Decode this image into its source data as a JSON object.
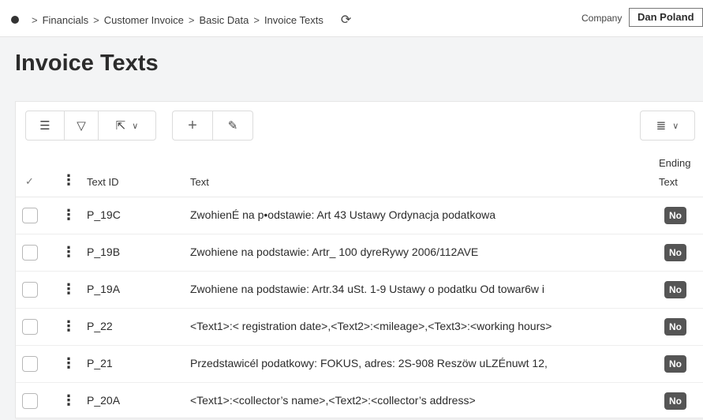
{
  "breadcrumb": {
    "items": [
      "Financials",
      "Customer Invoice",
      "Basic Data",
      "Invoice Texts"
    ],
    "separator": ">"
  },
  "company": {
    "label": "Company",
    "value": "Dan Poland"
  },
  "page": {
    "title": "Invoice Texts"
  },
  "toolbar": {
    "icons": [
      "list-icon",
      "filter-icon",
      "export-icon",
      "add-icon",
      "edit-icon",
      "column-settings-icon"
    ]
  },
  "table": {
    "columns": {
      "text_id": "Text ID",
      "text": "Text",
      "ending_line1": "Ending",
      "ending_line2": "Text"
    },
    "rows": [
      {
        "id": "P_19C",
        "text": "ZwohienÉ na p•odstawie: Art 43 Ustawy Ordynacja podatkowa",
        "ending": "No"
      },
      {
        "id": "P_19B",
        "text": "Zwohiene na podstawie: Artr_ 100 dyreRywy 2006/112AVE",
        "ending": "No"
      },
      {
        "id": "P_19A",
        "text": "Zwohiene na podstawie: Artr.34 uSt. 1-9 Ustawy o podatku Od towar6w i",
        "ending": "No"
      },
      {
        "id": "P_22",
        "text": "<Text1>:< registration date>,<Text2>:<mileage>,<Text3>:<working hours>",
        "ending": "No"
      },
      {
        "id": "P_21",
        "text": "Przedstawicél podatkowy: FOKUS, adres: 2S-908 Reszöw uLZÉnuwt 12,",
        "ending": "No"
      },
      {
        "id": "P_20A",
        "text": "<Text1>:<collector’s name>,<Text2>:<collector’s address>",
        "ending": "No"
      }
    ]
  }
}
